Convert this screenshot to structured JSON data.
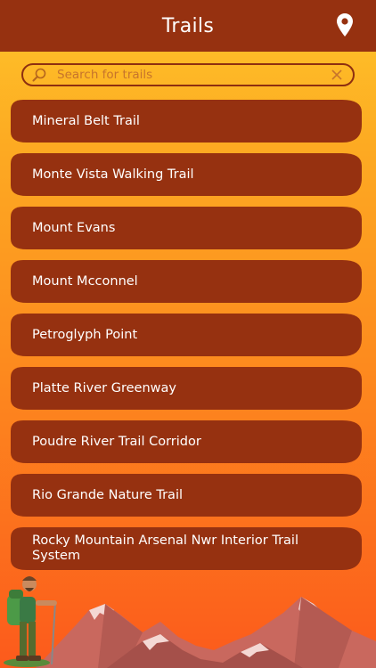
{
  "header": {
    "title": "Trails",
    "location_icon": "map-pin-icon"
  },
  "search": {
    "placeholder": "Search for trails",
    "value": "",
    "search_icon": "search-icon",
    "clear_icon": "close-icon"
  },
  "trails": [
    {
      "label": "Mineral Belt Trail"
    },
    {
      "label": "Monte Vista Walking Trail"
    },
    {
      "label": "Mount Evans"
    },
    {
      "label": "Mount Mcconnel"
    },
    {
      "label": "Petroglyph Point"
    },
    {
      "label": "Platte River Greenway"
    },
    {
      "label": "Poudre River Trail Corridor"
    },
    {
      "label": "Rio Grande Nature Trail"
    },
    {
      "label": "Rocky Mountain Arsenal Nwr Interior Trail System"
    }
  ],
  "colors": {
    "header": "#963110",
    "item": "#963110",
    "gradient_top": "#fec52a",
    "gradient_bottom": "#fc5a1c"
  }
}
